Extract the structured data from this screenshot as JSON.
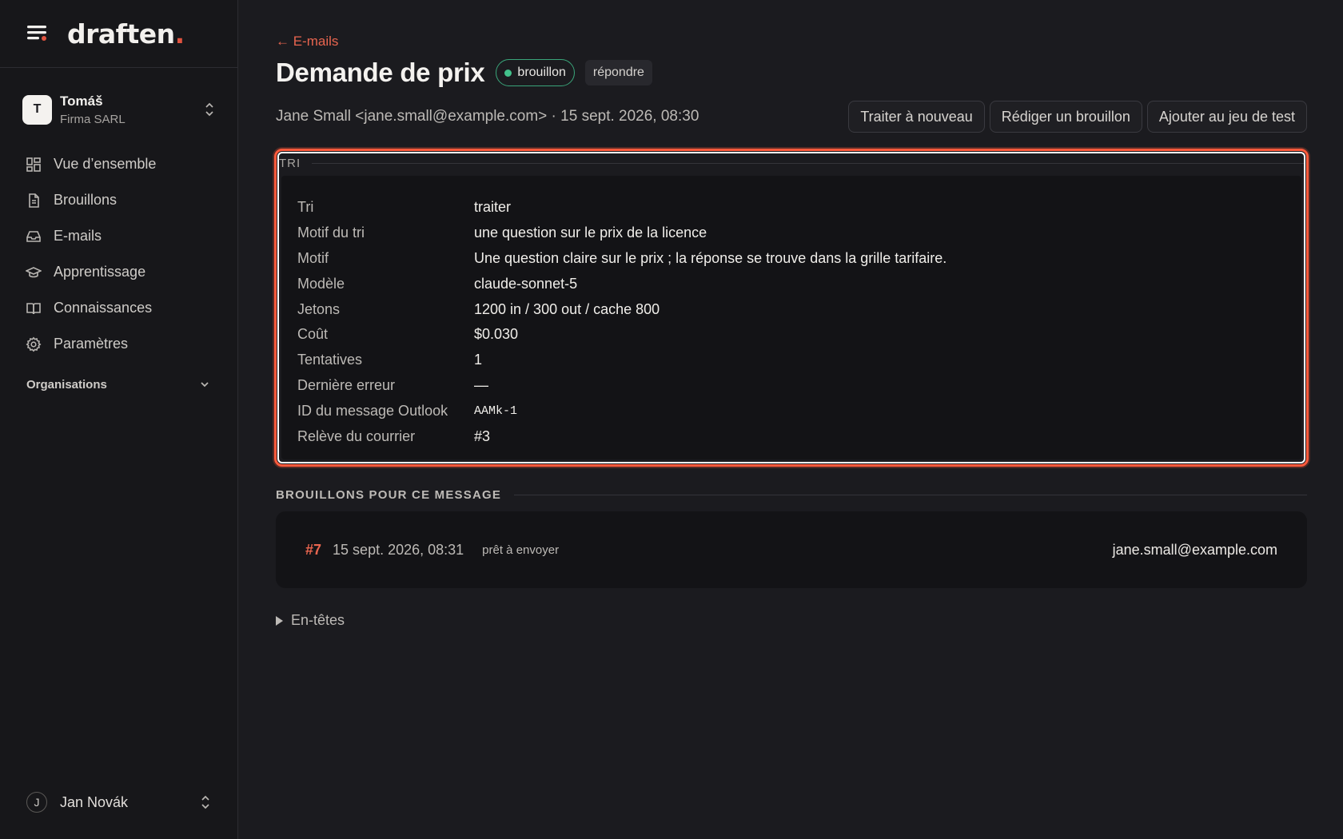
{
  "brand": {
    "name": "draften",
    "dot": "."
  },
  "org": {
    "initial": "T",
    "name": "Tomáš",
    "company": "Firma SARL"
  },
  "nav": [
    {
      "label": "Vue d’ensemble",
      "icon": "grid-icon"
    },
    {
      "label": "Brouillons",
      "icon": "document-icon"
    },
    {
      "label": "E-mails",
      "icon": "inbox-icon"
    },
    {
      "label": "Apprentissage",
      "icon": "graduation-cap-icon"
    },
    {
      "label": "Connaissances",
      "icon": "book-icon"
    },
    {
      "label": "Paramètres",
      "icon": "gear-icon"
    }
  ],
  "organisations_label": "Organisations",
  "user": {
    "initial": "J",
    "name": "Jan Novák"
  },
  "page": {
    "back_label": "← E-mails",
    "title": "Demande de prix",
    "status_badge": "brouillon",
    "tag_badge": "répondre",
    "meta": "Jane Small <jane.small@example.com> · 15 sept. 2026, 08:30",
    "actions": {
      "reprocess": "Traiter à nouveau",
      "draft": "Rédiger un brouillon",
      "add_test": "Ajouter au jeu de test"
    }
  },
  "triage": {
    "heading": "TRI",
    "rows": [
      {
        "key": "Tri",
        "value": "traiter"
      },
      {
        "key": "Motif du tri",
        "value": "une question sur le prix de la licence"
      },
      {
        "key": "Motif",
        "value": "Une question claire sur le prix ; la réponse se trouve dans la grille tarifaire."
      },
      {
        "key": "Modèle",
        "value": "claude-sonnet-5"
      },
      {
        "key": "Jetons",
        "value": "1200 in / 300 out / cache 800"
      },
      {
        "key": "Coût",
        "value": "$0.030"
      },
      {
        "key": "Tentatives",
        "value": "1"
      },
      {
        "key": "Dernière erreur",
        "value": "—"
      },
      {
        "key": "ID du message Outlook",
        "value": "AAMk-1"
      },
      {
        "key": "Relève du courrier",
        "value": "#3"
      }
    ]
  },
  "drafts": {
    "heading": "BROUILLONS POUR CE MESSAGE",
    "items": [
      {
        "id": "#7",
        "date": "15 sept. 2026, 08:31",
        "status": "prêt à envoyer",
        "recipient": "jane.small@example.com"
      }
    ]
  },
  "headers_toggle": "En-têtes",
  "colors": {
    "accent": "#e8654f",
    "status_green": "#42c18b",
    "highlight": "#ff5a3c"
  }
}
